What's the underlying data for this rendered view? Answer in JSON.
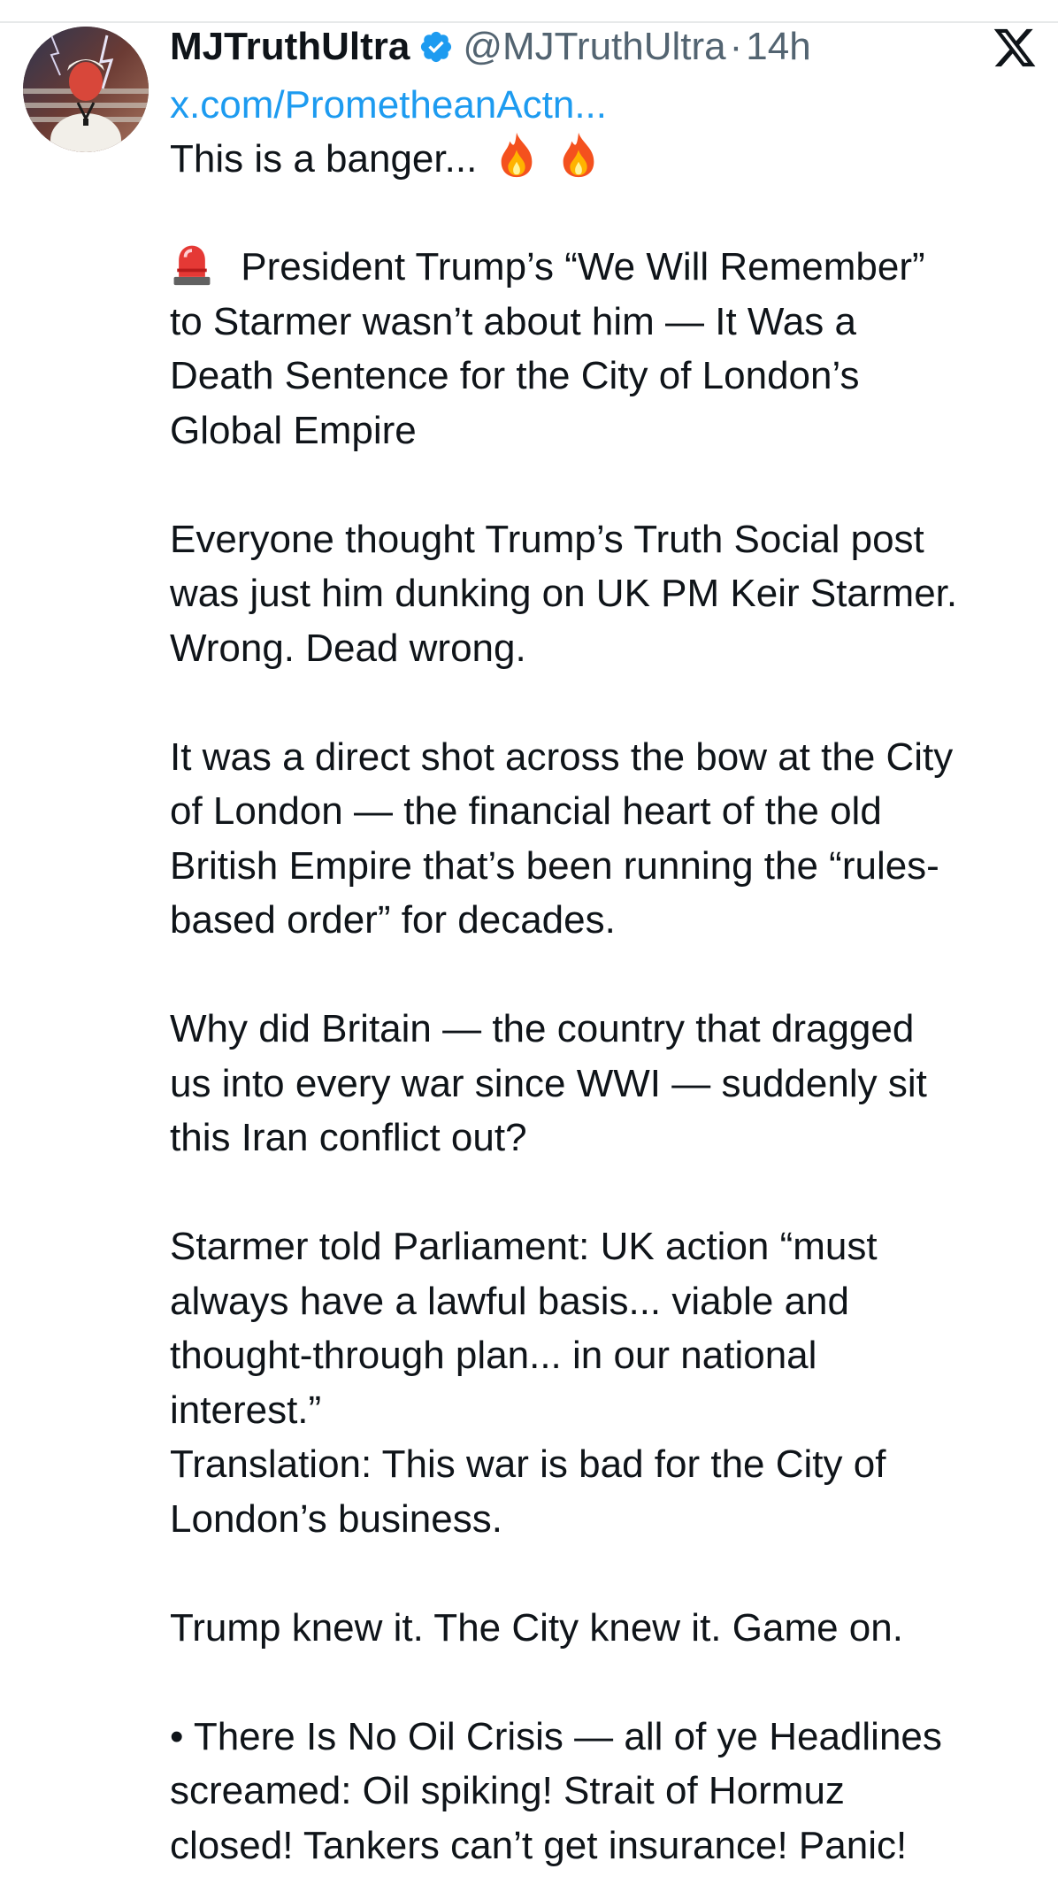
{
  "tweet": {
    "display_name": "MJTruthUltra",
    "handle": "@MJTruthUltra",
    "separator": "·",
    "time": "14h",
    "link": "x.com/PrometheanActn...",
    "intro": "This is a banger...",
    "headline_lines": [
      "President Trump’s “We Will Remember”",
      "to Starmer wasn’t about him — It Was a",
      "Death Sentence for the City of London’s",
      "Global Empire"
    ],
    "para1_lines": [
      "Everyone thought Trump’s Truth Social post",
      "was just him dunking on UK PM Keir Starmer.",
      "Wrong. Dead wrong."
    ],
    "para2_lines": [
      "It was a direct shot across the bow at the City",
      "of London — the financial heart of the old",
      "British Empire that’s been running the “rules-",
      "based order” for decades."
    ],
    "para3_lines": [
      "Why did Britain — the country that dragged",
      "us into every war since WWI — suddenly sit",
      "this Iran conflict out?"
    ],
    "para4_lines": [
      "Starmer told Parliament: UK action “must",
      "always have a lawful basis... viable and",
      "thought-through plan... in our national",
      "interest.”",
      "Translation: This war is bad for the City of",
      "London’s business."
    ],
    "para5_lines": [
      "Trump knew it. The City knew it. Game on."
    ],
    "para6_lines": [
      "• There Is No Oil Crisis — all of ye Headlines",
      "screamed: Oil spiking! Strait of Hormuz",
      "closed! Tankers can’t get insurance! Panic!"
    ]
  },
  "icons": {
    "verified": "verified-badge-icon",
    "close": "x-logo-icon",
    "fire": "fire-emoji",
    "siren": "police-siren-emoji"
  },
  "colors": {
    "text": "#0f1419",
    "secondary": "#536471",
    "link": "#1d9bf0",
    "verified": "#1d9bf0"
  }
}
